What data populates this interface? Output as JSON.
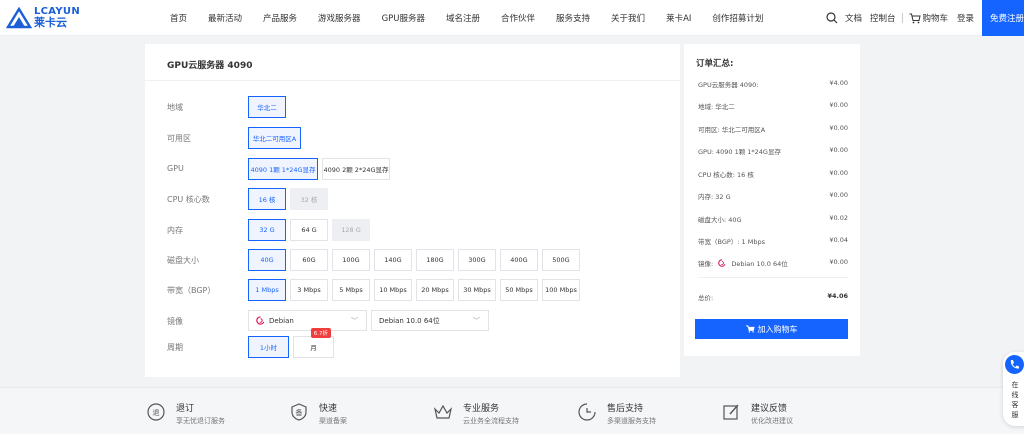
{
  "brand": {
    "logo_text": "LCAYUN",
    "logo_cn": "莱卡云",
    "color": "#1664ff"
  },
  "nav": [
    "首页",
    "最新活动",
    "产品服务",
    "游戏服务器",
    "GPU服务器",
    "域名注册",
    "合作伙伴",
    "服务支持",
    "关于我们",
    "莱卡AI",
    "创作招募计划"
  ],
  "header_right": {
    "docs": "文档",
    "console": "控制台",
    "cart": "购物车",
    "login": "登录",
    "register": "免费注册"
  },
  "config": {
    "title": "GPU云服务器 4090",
    "region": {
      "label": "地域",
      "options": [
        "华北二"
      ]
    },
    "zone": {
      "label": "可用区",
      "options": [
        "华北二可用区A"
      ]
    },
    "gpu": {
      "label": "GPU",
      "options": [
        "4090 1颗 1*24G显存",
        "4090 2颗 2*24G显存"
      ]
    },
    "cpu": {
      "label": "CPU 核心数",
      "options": [
        "16 核",
        "32 核"
      ]
    },
    "memory": {
      "label": "内存",
      "options": [
        "32 G",
        "64 G",
        "128 G"
      ]
    },
    "disk": {
      "label": "磁盘大小",
      "options": [
        "40G",
        "60G",
        "100G",
        "140G",
        "180G",
        "300G",
        "400G",
        "500G"
      ]
    },
    "bandwidth": {
      "label": "带宽（BGP）",
      "options": [
        "1 Mbps",
        "3 Mbps",
        "5 Mbps",
        "10 Mbps",
        "20 Mbps",
        "30 Mbps",
        "50 Mbps",
        "100 Mbps"
      ]
    },
    "image": {
      "label": "镜像",
      "os": "Debian",
      "version": "Debian 10.0 64位"
    },
    "period": {
      "label": "周期",
      "options": [
        "1小时",
        "月"
      ],
      "badge": "6.7折"
    }
  },
  "summary": {
    "title": "订单汇总:",
    "rows": [
      {
        "k": "GPU云服务器 4090:",
        "v": "¥4.00"
      },
      {
        "k": "地域: 华北二",
        "v": "¥0.00"
      },
      {
        "k": "可用区: 华北二可用区A",
        "v": "¥0.00"
      },
      {
        "k": "GPU: 4090 1颗 1*24G显存",
        "v": "¥0.00"
      },
      {
        "k": "CPU 核心数: 16 核",
        "v": "¥0.00"
      },
      {
        "k": "内存: 32 G",
        "v": "¥0.00"
      },
      {
        "k": "磁盘大小: 40G",
        "v": "¥0.02"
      },
      {
        "k": "带宽（BGP）: 1 Mbps",
        "v": "¥0.04"
      }
    ],
    "image_key": "镜像:",
    "image_val": "Debian 10.0 64位",
    "image_price": "¥0.00",
    "total_key": "总价:",
    "total_val": "¥4.06",
    "cart_button": "加入购物车"
  },
  "features": [
    {
      "t1": "退订",
      "t2": "享无忧退订服务"
    },
    {
      "t1": "快速",
      "t2": "渠道备案"
    },
    {
      "t1": "专业服务",
      "t2": "云业务全流程支持"
    },
    {
      "t1": "售后支持",
      "t2": "多渠道服务支持"
    },
    {
      "t1": "建议反馈",
      "t2": "优化改进建议"
    }
  ],
  "float_service": "在线客服"
}
